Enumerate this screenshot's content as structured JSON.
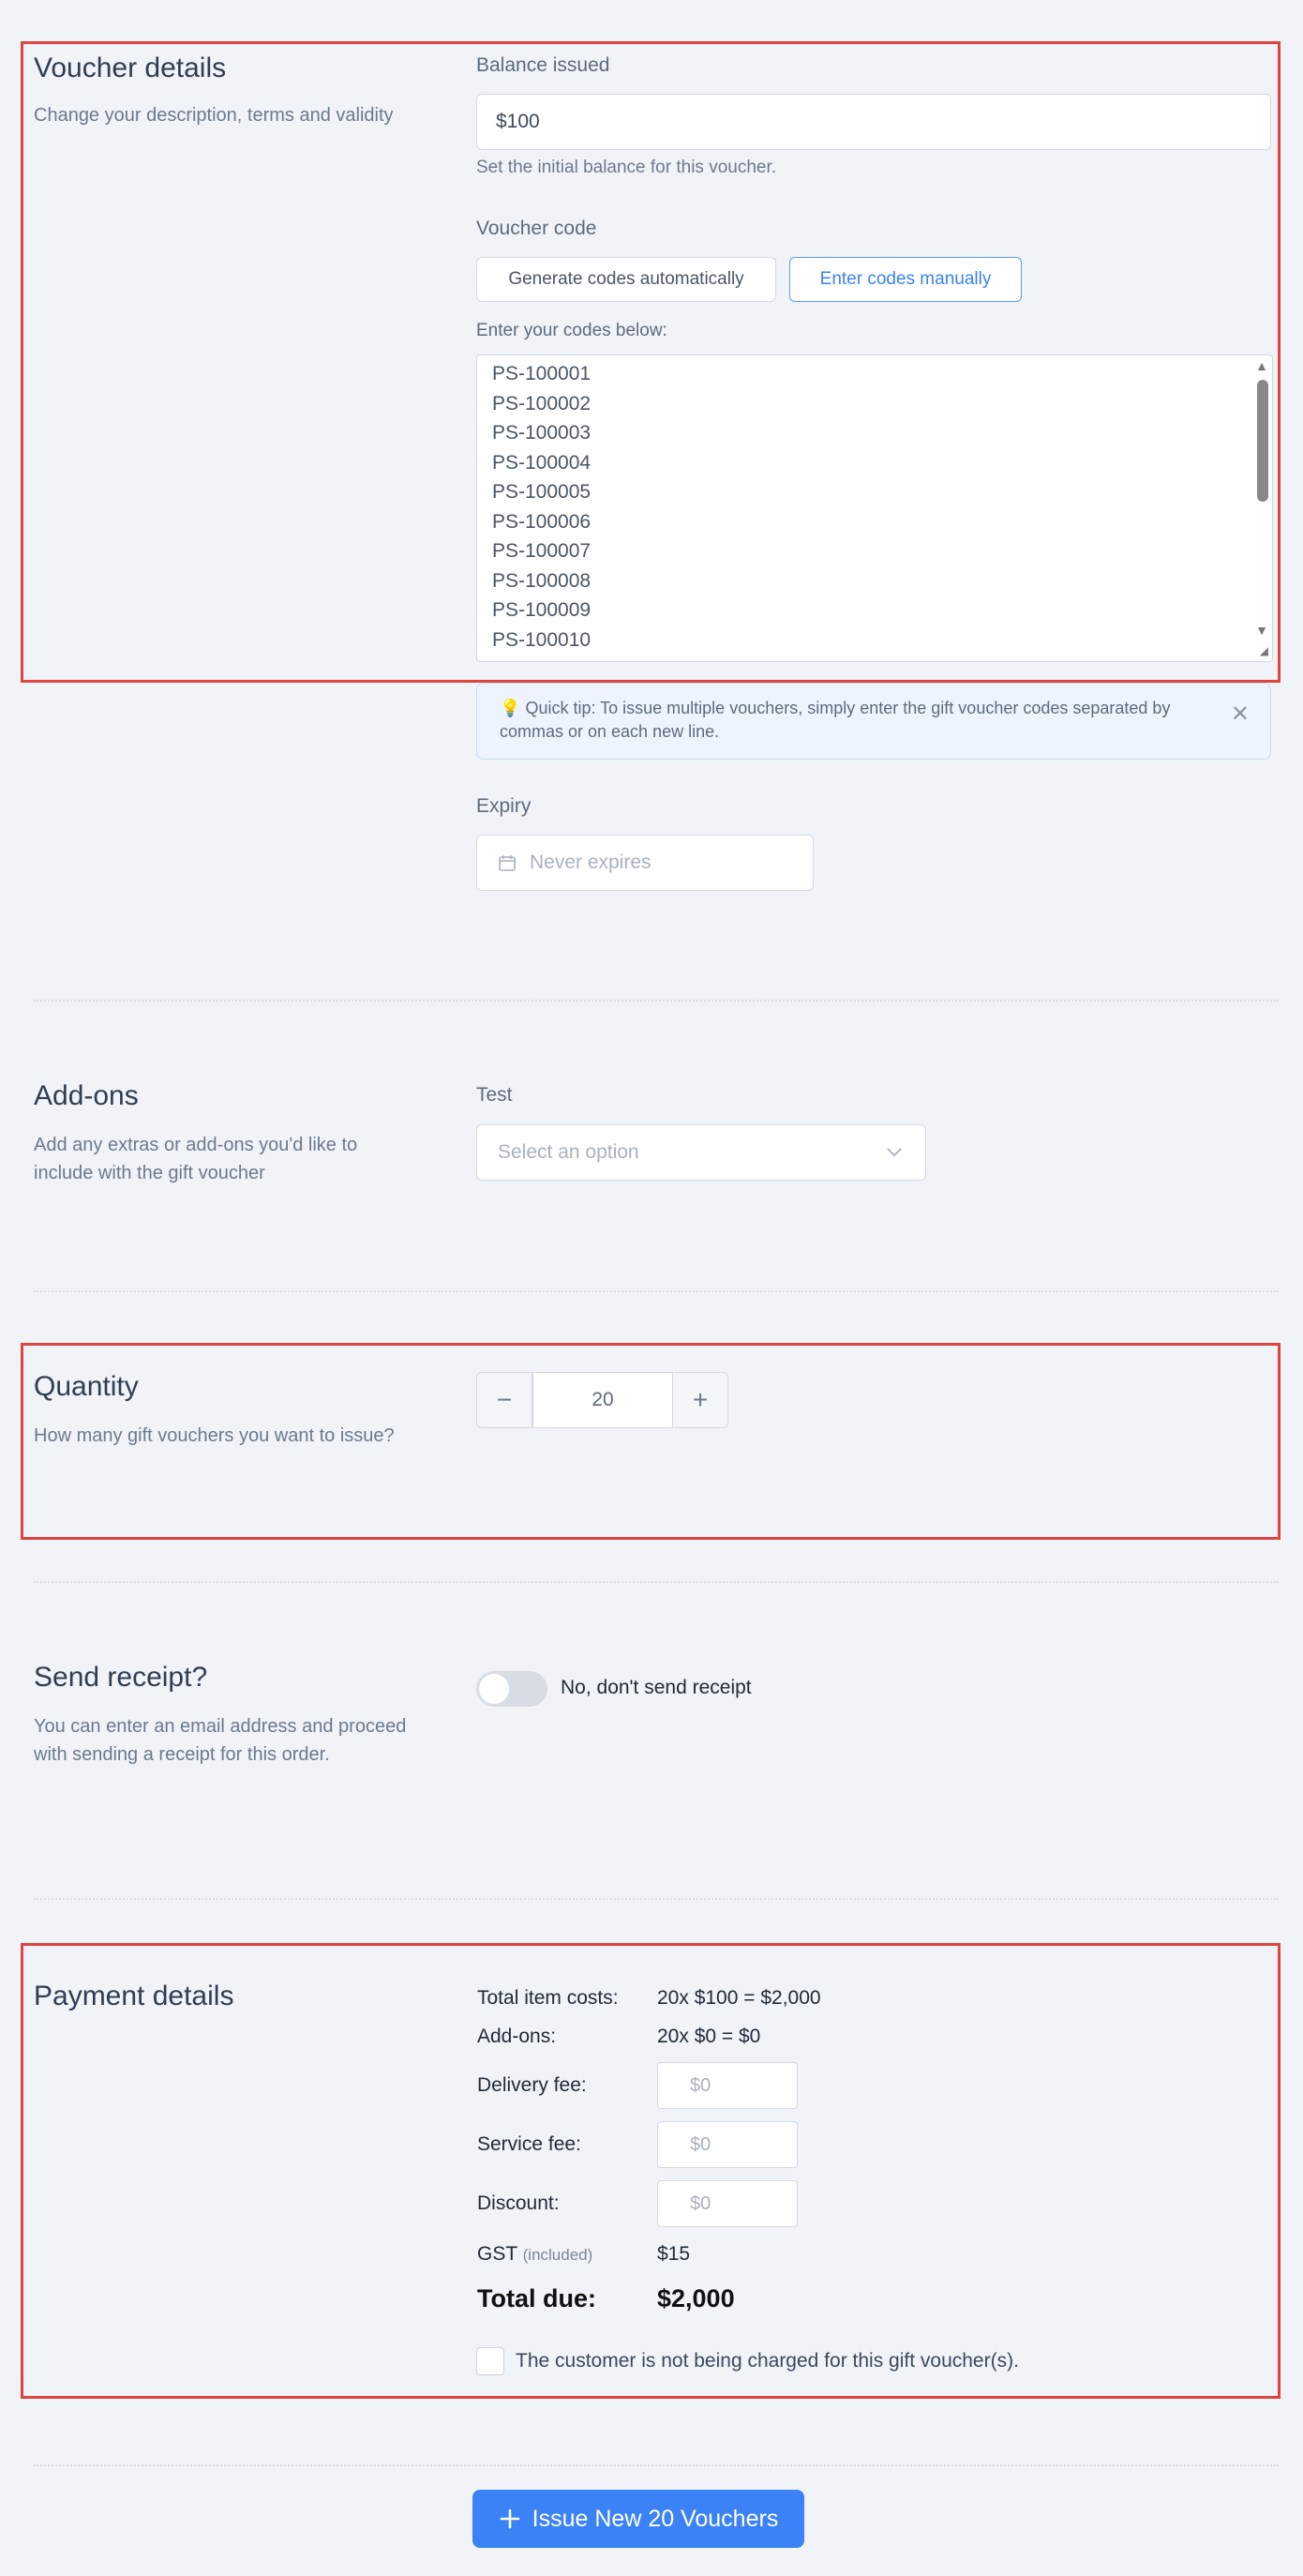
{
  "voucher_details": {
    "title": "Voucher details",
    "description": "Change your description, terms and validity",
    "balance_label": "Balance issued",
    "balance_value": "$100",
    "balance_help": "Set the initial balance for this voucher.",
    "code_label": "Voucher code",
    "generate_button": "Generate codes automatically",
    "manual_button": "Enter codes manually",
    "codes_label": "Enter your codes below:",
    "codes": [
      "PS-100001",
      "PS-100002",
      "PS-100003",
      "PS-100004",
      "PS-100005",
      "PS-100006",
      "PS-100007",
      "PS-100008",
      "PS-100009",
      "PS-100010"
    ],
    "tip_icon": "lightbulb-icon",
    "tip_text": "Quick tip: To issue multiple vouchers, simply enter the gift voucher codes separated by commas or on each new line.",
    "expiry_label": "Expiry",
    "expiry_placeholder": "Never expires"
  },
  "addons": {
    "title": "Add-ons",
    "description": "Add any extras or add-ons you'd like to include with the gift voucher",
    "field_label": "Test",
    "select_placeholder": "Select an option"
  },
  "quantity": {
    "title": "Quantity",
    "description": "How many gift vouchers you want to issue?",
    "value": "20",
    "minus": "−",
    "plus": "+"
  },
  "receipt": {
    "title": "Send receipt?",
    "description": "You can enter an email address and proceed with sending a receipt for this order.",
    "toggle_label": "No, don't send receipt",
    "toggle_on": false
  },
  "payment": {
    "title": "Payment details",
    "total_items_label": "Total item costs:",
    "total_items_value": "20x $100 = $2,000",
    "addons_label": "Add-ons:",
    "addons_value": "20x $0 = $0",
    "delivery_label": "Delivery fee:",
    "delivery_placeholder": "$0",
    "service_label": "Service fee:",
    "service_placeholder": "$0",
    "discount_label": "Discount:",
    "discount_placeholder": "$0",
    "gst_label": "GST",
    "gst_note": "(included)",
    "gst_value": "$15",
    "total_label": "Total due:",
    "total_value": "$2,000",
    "no_charge_label": "The customer is not being charged for this gift voucher(s)."
  },
  "submit_button": "Issue New 20 Vouchers",
  "colors": {
    "accent": "#3b82f6",
    "highlight": "#e0443f",
    "background": "#f0f3f8"
  }
}
